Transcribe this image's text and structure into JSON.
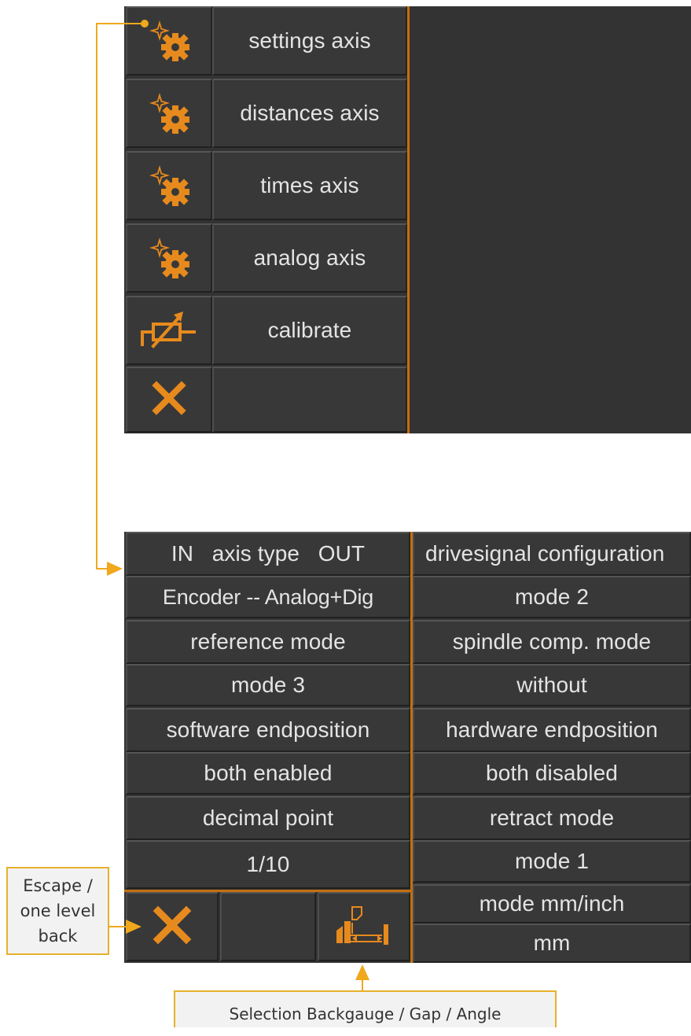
{
  "top_menu": {
    "items": [
      {
        "label": "settings axis",
        "icon": "gear-sparkle-icon"
      },
      {
        "label": "distances axis",
        "icon": "gear-sparkle-icon"
      },
      {
        "label": "times axis",
        "icon": "gear-sparkle-icon"
      },
      {
        "label": "analog axis",
        "icon": "gear-sparkle-icon"
      },
      {
        "label": "calibrate",
        "icon": "calibrate-icon"
      },
      {
        "label": "",
        "icon": "close-icon"
      }
    ]
  },
  "settings_grid": {
    "left": [
      {
        "header": "IN   axis type   OUT",
        "value": "Encoder -- Analog+Dig"
      },
      {
        "header": "reference mode",
        "value": "mode 3"
      },
      {
        "header": "software endposition",
        "value": "both enabled"
      },
      {
        "header": "decimal point",
        "value": "1/10"
      }
    ],
    "right": [
      {
        "header": "drivesignal configuration",
        "value": "mode 2"
      },
      {
        "header": "spindle comp. mode",
        "value": "without"
      },
      {
        "header": "hardware endposition",
        "value": "both disabled"
      },
      {
        "header": "retract mode",
        "value": "mode 1"
      },
      {
        "header": "mode mm/inch",
        "value": "mm"
      }
    ]
  },
  "annotations": {
    "escape": "Escape /\none level\nback",
    "selection": "Selection Backgauge / Gap / Angle"
  },
  "colors": {
    "accent": "#e78a1d",
    "panel_bg": "#333333",
    "button_bg": "#383838",
    "callout_border": "#e7b12b",
    "connector": "#f0a81c"
  }
}
